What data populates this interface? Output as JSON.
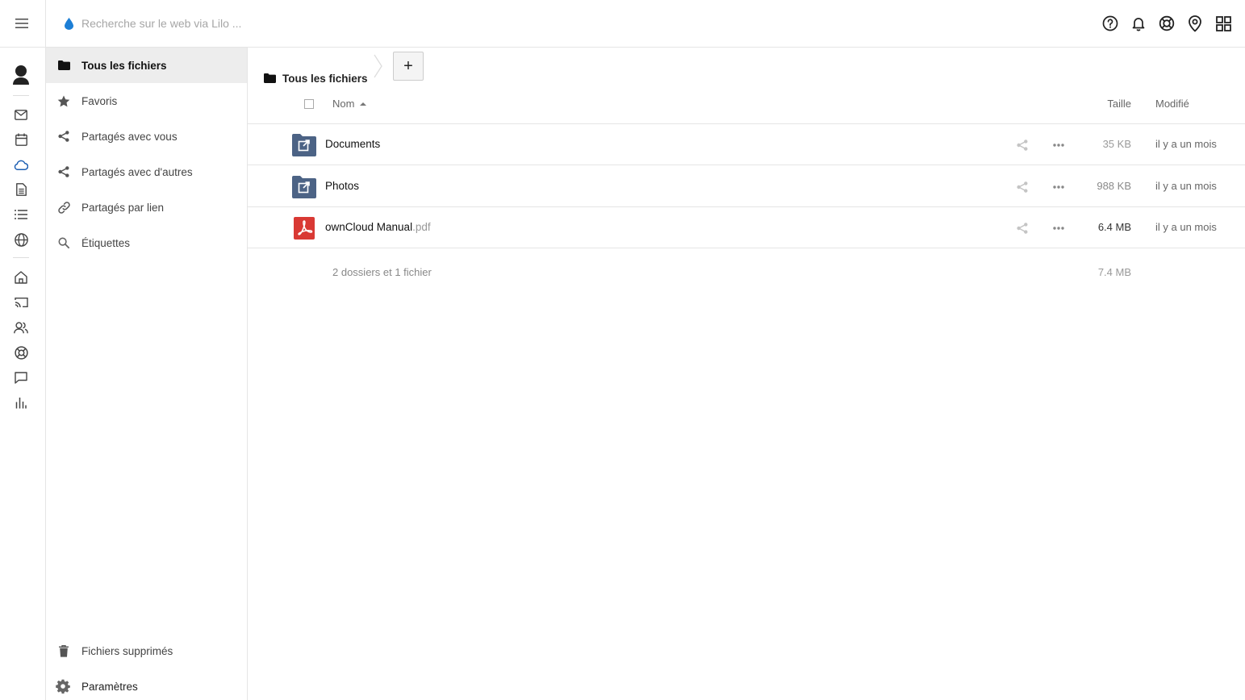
{
  "search": {
    "placeholder": "Recherche sur le web via Lilo ..."
  },
  "top_icons": [
    "help-icon",
    "bell-icon",
    "lifebuoy-icon",
    "location-icon",
    "apps-grid-icon"
  ],
  "rail": [
    "avatar",
    "mail-icon",
    "calendar-icon",
    "cloud-icon",
    "document-icon",
    "list-icon",
    "globe-icon",
    "home-icon",
    "cast-icon",
    "users-icon",
    "lifebuoy-icon",
    "chat-icon",
    "chart-icon"
  ],
  "colors": {
    "accent": "#1d5fb3",
    "folder": "#4c6385",
    "pdf": "#d93934"
  },
  "nav": {
    "items": [
      {
        "label": "Tous les fichiers",
        "icon": "folder-icon"
      },
      {
        "label": "Favoris",
        "icon": "star-icon"
      },
      {
        "label": "Partagés avec vous",
        "icon": "share-icon"
      },
      {
        "label": "Partagés avec d'autres",
        "icon": "share-icon"
      },
      {
        "label": "Partagés par lien",
        "icon": "link-icon"
      },
      {
        "label": "Étiquettes",
        "icon": "search-icon"
      }
    ],
    "deleted": "Fichiers supprimés",
    "settings": "Paramètres"
  },
  "breadcrumb": {
    "label": "Tous les fichiers"
  },
  "add_button": "+",
  "table": {
    "headers": {
      "name": "Nom",
      "size": "Taille",
      "modified": "Modifié"
    },
    "rows": [
      {
        "name": "Documents",
        "ext": "",
        "type": "shared-folder",
        "size": "35 KB",
        "size_color": "#9a9a9a",
        "modified": "il y a un mois"
      },
      {
        "name": "Photos",
        "ext": "",
        "type": "shared-folder",
        "size": "988 KB",
        "size_color": "#8a8a8a",
        "modified": "il y a un mois"
      },
      {
        "name": "ownCloud Manual",
        "ext": ".pdf",
        "type": "pdf",
        "size": "6.4 MB",
        "size_color": "#333333",
        "modified": "il y a un mois"
      }
    ],
    "summary": "2 dossiers et 1 fichier",
    "summary_size": "7.4 MB"
  }
}
